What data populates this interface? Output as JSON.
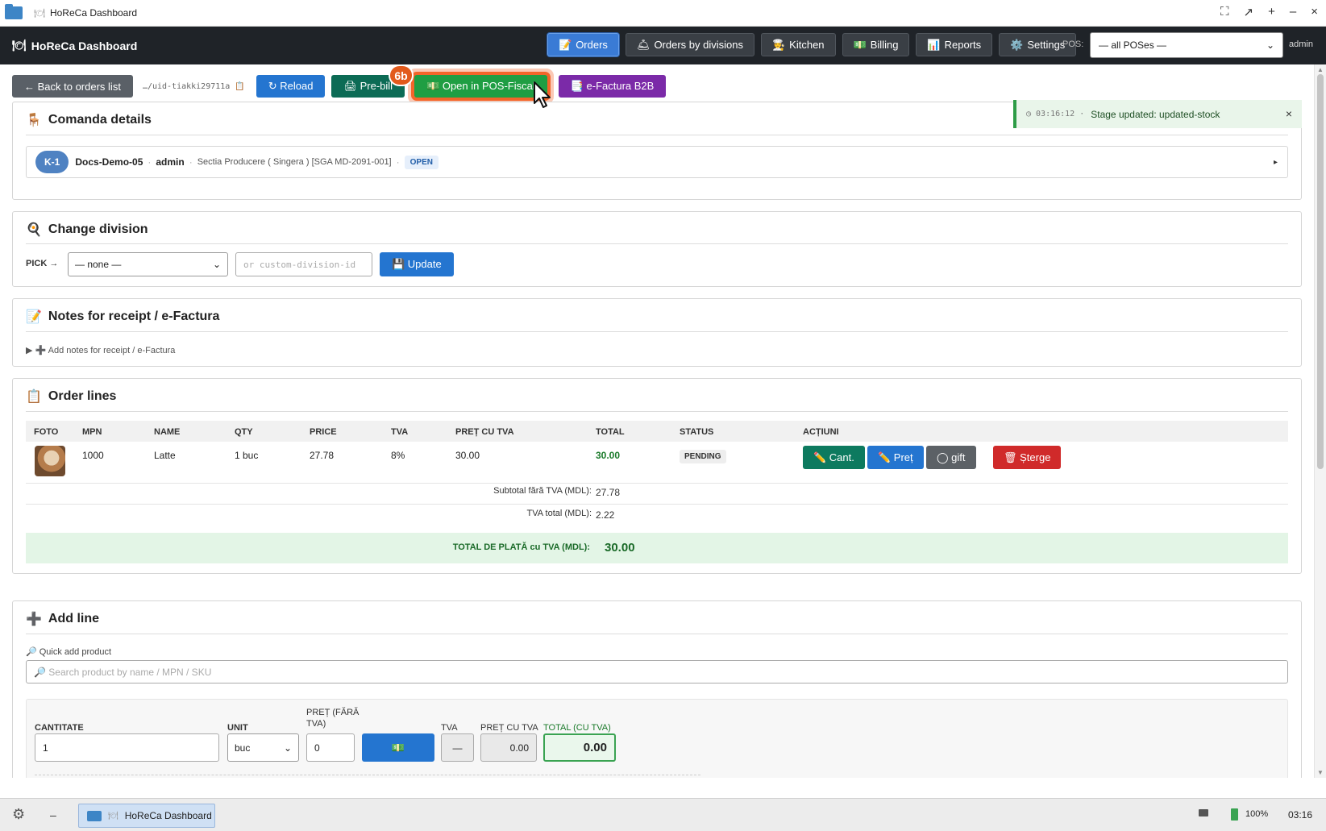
{
  "window": {
    "title": "HoReCa Dashboard",
    "controls": [
      "⛶",
      "↗",
      "+",
      "–",
      "×"
    ]
  },
  "topnav": {
    "brand": "HoReCa Dashboard",
    "brand_icon": "🍽",
    "items": [
      {
        "icon": "📝",
        "label": "Orders",
        "active": true
      },
      {
        "icon": "🛎",
        "label": "Orders by divisions",
        "active": false
      },
      {
        "icon": "🧑‍🍳",
        "label": "Kitchen",
        "active": false
      },
      {
        "icon": "💵",
        "label": "Billing",
        "active": false
      },
      {
        "icon": "📊",
        "label": "Reports",
        "active": false
      },
      {
        "icon": "⚙️",
        "label": "Settings",
        "active": false
      }
    ],
    "pos_label": "POS:",
    "pos_value": "— all POSes —",
    "user": "admin"
  },
  "actions": {
    "back": "← Back to orders list",
    "uid": "…/uid-tiakki29711a",
    "uid_copy_icon": "📋",
    "reload": "↻ Reload",
    "prebill": "🖨 Pre-bill",
    "open_pos": "💵 Open in POS-Fiscal",
    "efactura": "📑 e-Factura B2B",
    "step_badge": "6b"
  },
  "toast": {
    "time": "◷  03:16:12",
    "dot": "·",
    "message": "Stage updated: updated-stock",
    "close": "×"
  },
  "comanda": {
    "title": "Comanda details",
    "icon": "🪑",
    "tag": "K-1",
    "name": "Docs-Demo-05",
    "user": "admin",
    "division": "Sectia Producere ( Singera ) [SGA MD-2091-001]",
    "status": "OPEN",
    "expand": "▸"
  },
  "division": {
    "title": "Change division",
    "icon": "🍳",
    "pick_label": "PICK →",
    "select_value": "— none —",
    "custom_placeholder": "or custom-division-id",
    "update": "💾 Update"
  },
  "notes": {
    "title": "Notes for receipt / e-Factura",
    "icon": "📝",
    "toggle": "▶ ➕ Add notes for receipt / e-Factura"
  },
  "orderlines": {
    "title": "Order lines",
    "icon": "📋",
    "headers": [
      "FOTO",
      "MPN",
      "NAME",
      "QTY",
      "PRICE",
      "TVA",
      "PREȚ CU TVA",
      "TOTAL",
      "STATUS",
      "ACȚIUNI"
    ],
    "row": {
      "mpn": "1000",
      "name": "Latte",
      "qty": "1 buc",
      "price": "27.78",
      "tva": "8%",
      "pret_tva": "30.00",
      "total": "30.00",
      "status": "PENDING"
    },
    "row_actions": {
      "cant": "✏️ Cant.",
      "pret": "✏️ Preț",
      "gift": "◯ gift",
      "sterge": "🗑 Șterge"
    },
    "subtotal_label": "Subtotal fără TVA (MDL):",
    "subtotal": "27.78",
    "tva_label": "TVA total (MDL):",
    "tva_total": "2.22",
    "grand_label": "TOTAL DE PLATĂ cu TVA (MDL):",
    "grand_total": "30.00"
  },
  "addline": {
    "title": "Add line",
    "icon": "➕",
    "quick_label": "🔎 Quick add product",
    "search_placeholder": "🔎 Search product by name / MPN / SKU",
    "cantitate_label": "CANTITATE",
    "cantitate": "1",
    "unit_label": "UNIT",
    "unit": "buc",
    "pret_label_1": "PREȚ (FĂRĂ",
    "pret_label_2": "TVA)",
    "pret": "0",
    "money_icon": "💵",
    "tva_label": "TVA",
    "tva": "—",
    "pret_tva_label": "PREȚ CU TVA",
    "pret_tva": "0.00",
    "total_label": "TOTAL (CU TVA)",
    "total": "0.00"
  },
  "taskbar": {
    "item": "HoReCa Dashboard",
    "battery": "100%",
    "clock": "03:16"
  }
}
